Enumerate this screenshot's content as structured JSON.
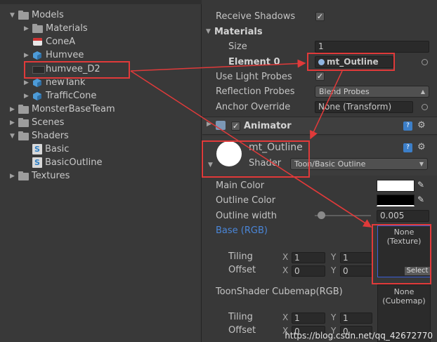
{
  "project_tree": {
    "items": [
      {
        "label": "Models",
        "icon": "folder-icon",
        "expanded": true
      },
      {
        "label": "Materials",
        "icon": "folder-icon",
        "expanded": false
      },
      {
        "label": "ConeA",
        "icon": "material-icon"
      },
      {
        "label": "Humvee",
        "icon": "prefab-icon",
        "expanded": false
      },
      {
        "label": "humvee_D2",
        "icon": "mesh-icon"
      },
      {
        "label": "newTank",
        "icon": "prefab-icon",
        "expanded": false
      },
      {
        "label": "TrafficCone",
        "icon": "prefab-icon",
        "expanded": false
      },
      {
        "label": "MonsterBaseTeam",
        "icon": "folder-icon",
        "expanded": false
      },
      {
        "label": "Scenes",
        "icon": "folder-icon",
        "expanded": false
      },
      {
        "label": "Shaders",
        "icon": "folder-icon",
        "expanded": true
      },
      {
        "label": "Basic",
        "icon": "shader-icon"
      },
      {
        "label": "BasicOutline",
        "icon": "shader-icon"
      },
      {
        "label": "Textures",
        "icon": "folder-icon",
        "expanded": false
      }
    ]
  },
  "renderer": {
    "receive_shadows_label": "Receive Shadows",
    "receive_shadows_checked": true,
    "materials_label": "Materials",
    "size_label": "Size",
    "size_value": "1",
    "element0_label": "Element 0",
    "element0_value": "mt_Outline",
    "use_light_probes_label": "Use Light Probes",
    "use_light_probes_checked": true,
    "reflection_probes_label": "Reflection Probes",
    "reflection_probes_value": "Blend Probes",
    "anchor_override_label": "Anchor Override",
    "anchor_override_value": "None (Transform)"
  },
  "animator": {
    "label": "Animator",
    "checked": true
  },
  "material": {
    "name": "mt_Outline",
    "shader_label": "Shader",
    "shader_value": "Toon/Basic Outline",
    "main_color_label": "Main Color",
    "main_color": "#ffffff",
    "outline_color_label": "Outline Color",
    "outline_color": "#000000",
    "outline_width_label": "Outline width",
    "outline_width_value": "0.005",
    "base_label": "Base (RGB)",
    "base_texture_line1": "None",
    "base_texture_line2": "(Texture)",
    "select_label": "Select",
    "tiling_label": "Tiling",
    "offset_label": "Offset",
    "x_label": "X",
    "y_label": "Y",
    "base_tiling_x": "1",
    "base_tiling_y": "1",
    "base_offset_x": "0",
    "base_offset_y": "0",
    "cubemap_label": "ToonShader Cubemap(RGB)",
    "cubemap_line1": "None",
    "cubemap_line2": "(Cubemap)",
    "cube_tiling_x": "1",
    "cube_tiling_y": "1",
    "cube_offset_x": "0",
    "cube_offset_y": "0"
  },
  "watermark": "https://blog.csdn.net/qq_42672770",
  "colors": {
    "annotation_red": "#e03a3a",
    "link_blue": "#4a86d8"
  }
}
